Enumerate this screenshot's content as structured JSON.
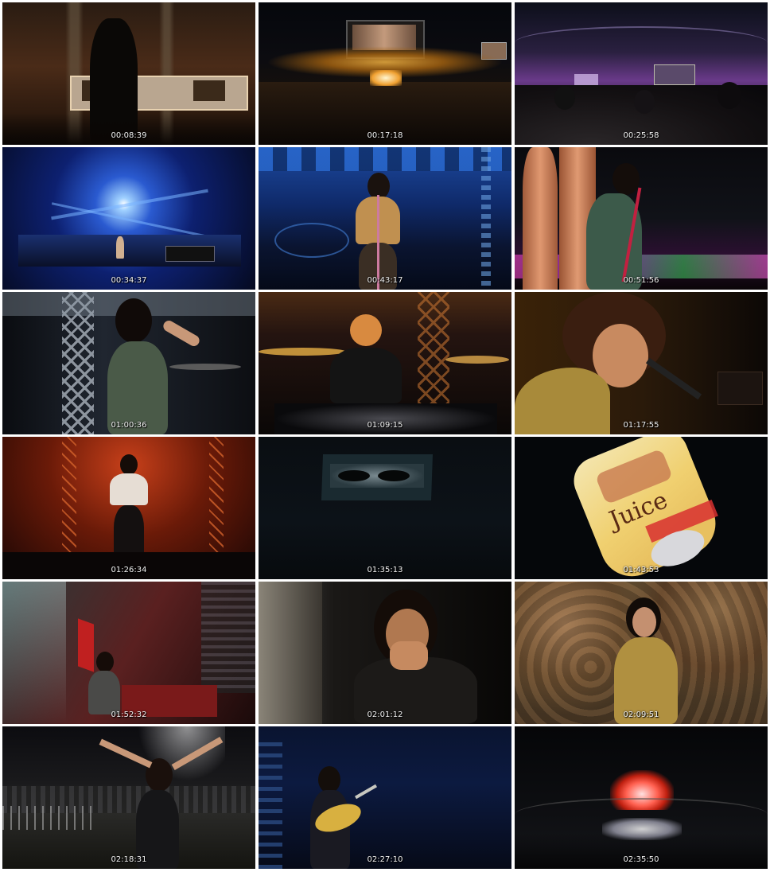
{
  "frames": [
    {
      "timestamp": "00:08:39",
      "scene": "stage-silhouette"
    },
    {
      "timestamp": "00:17:18",
      "scene": "stadium-wide-gold"
    },
    {
      "timestamp": "00:25:58",
      "scene": "stadium-purple-crowd"
    },
    {
      "timestamp": "00:34:37",
      "scene": "stage-blue-lights"
    },
    {
      "timestamp": "00:43:17",
      "scene": "singer-blue-stage"
    },
    {
      "timestamp": "00:51:56",
      "scene": "singer-neon-rig"
    },
    {
      "timestamp": "01:00:36",
      "scene": "singer-truss"
    },
    {
      "timestamp": "01:09:15",
      "scene": "drummer"
    },
    {
      "timestamp": "01:17:55",
      "scene": "singer-closeup-amber"
    },
    {
      "timestamp": "01:26:34",
      "scene": "singer-red-stage"
    },
    {
      "timestamp": "01:35:13",
      "scene": "screen-sunglasses"
    },
    {
      "timestamp": "01:43:53",
      "scene": "juice-balloon"
    },
    {
      "timestamp": "01:52:32",
      "scene": "singer-red-set"
    },
    {
      "timestamp": "02:01:12",
      "scene": "singer-closeup-dark"
    },
    {
      "timestamp": "02:09:51",
      "scene": "singer-crowd-backdrop"
    },
    {
      "timestamp": "02:18:31",
      "scene": "guitarist-arms-up"
    },
    {
      "timestamp": "02:27:10",
      "scene": "guitarist-blue"
    },
    {
      "timestamp": "02:35:50",
      "scene": "stadium-fireworks"
    }
  ],
  "balloon_text": "Juice"
}
